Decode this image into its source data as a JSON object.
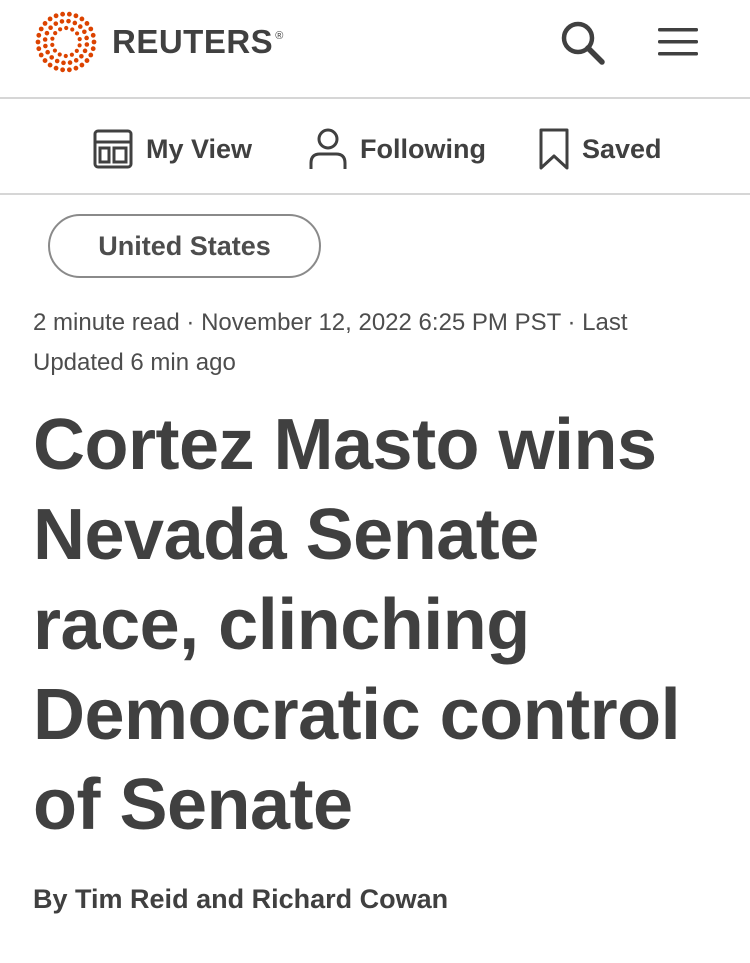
{
  "header": {
    "logo_text": "REUTERS",
    "logo_reg": "®",
    "brand_color": "#dc4300",
    "icons": {
      "search": "search-icon",
      "menu": "hamburger-menu-icon"
    }
  },
  "subnav": [
    {
      "label": "My View",
      "icon": "my-view-icon"
    },
    {
      "label": "Following",
      "icon": "person-icon"
    },
    {
      "label": "Saved",
      "icon": "bookmark-icon"
    }
  ],
  "article": {
    "tag": "United States",
    "meta": "2 minute read · November 12, 2022 6:25 PM PST · Last Updated 6 min ago",
    "headline": "Cortez Masto wins Nevada Senate race, clinching Democratic control of Senate",
    "byline_prefix": "By",
    "authors": [
      "Tim Reid",
      "Richard Cowan"
    ],
    "byline_joiner": "and"
  }
}
